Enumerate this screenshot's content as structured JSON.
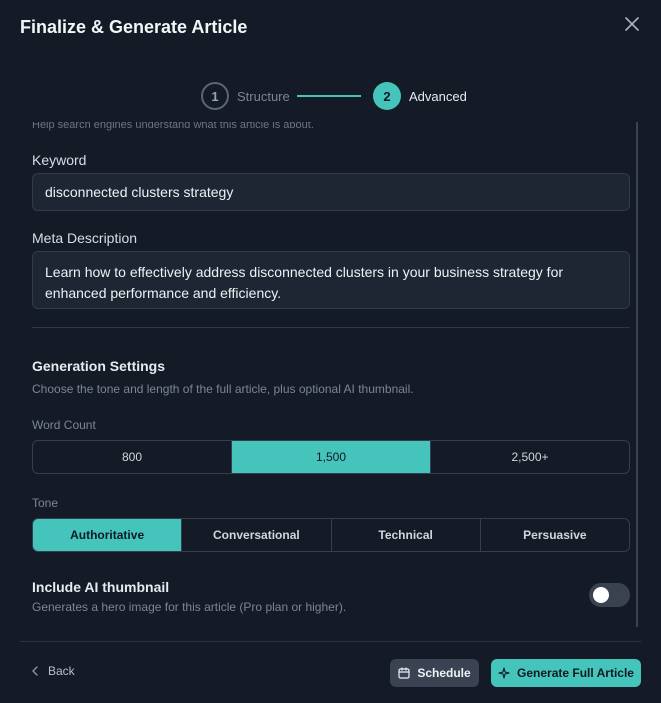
{
  "header": {
    "title": "Finalize & Generate Article"
  },
  "stepper": {
    "steps": [
      {
        "number": "1",
        "label": "Structure"
      },
      {
        "number": "2",
        "label": "Advanced"
      }
    ]
  },
  "seo": {
    "hint": "Help search engines understand what this article is about.",
    "keyword_label": "Keyword",
    "keyword_value": "disconnected clusters strategy",
    "meta_label": "Meta Description",
    "meta_value": "Learn how to effectively address disconnected clusters in your business strategy for enhanced performance and efficiency."
  },
  "generation": {
    "title": "Generation Settings",
    "description": "Choose the tone and length of the full article, plus optional AI thumbnail.",
    "word_count_label": "Word Count",
    "word_counts": [
      "800",
      "1,500",
      "2,500+"
    ],
    "word_count_selected": "1,500",
    "tone_label": "Tone",
    "tones": [
      "Authoritative",
      "Conversational",
      "Technical",
      "Persuasive"
    ],
    "tone_selected": "Authoritative",
    "thumbnail_title": "Include AI thumbnail",
    "thumbnail_description": "Generates a hero image for this article (Pro plan or higher).",
    "thumbnail_enabled": false
  },
  "footer": {
    "back_label": "Back",
    "schedule_label": "Schedule",
    "generate_label": "Generate Full Article"
  },
  "colors": {
    "accent": "#45c4bc",
    "background": "#151b26",
    "field_background": "#1d2632"
  },
  "icons": [
    "close-icon",
    "chevron-left-icon",
    "calendar-icon",
    "sparkle-icon"
  ]
}
